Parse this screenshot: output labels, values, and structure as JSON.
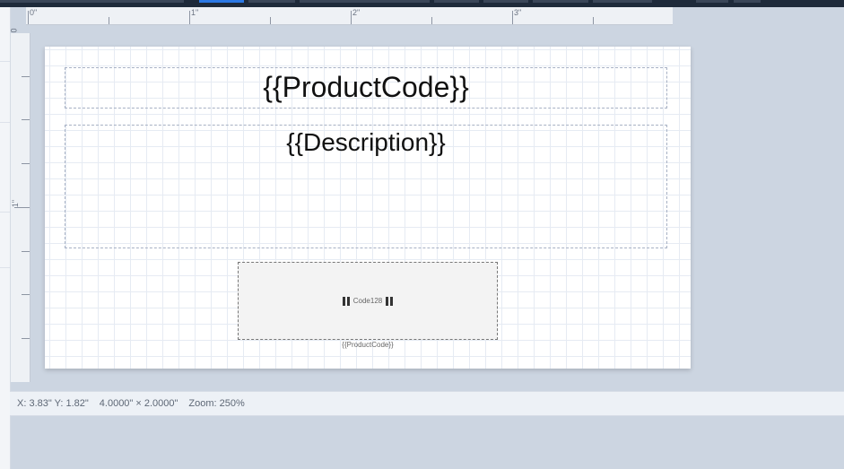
{
  "ruler": {
    "horizontal_labels": [
      "0\"",
      "1\"",
      "2\"",
      "3\""
    ],
    "vertical_labels": [
      "0",
      "1\""
    ]
  },
  "canvas": {
    "fields": {
      "product_code": "{{ProductCode}}",
      "description": "{{Description}}"
    },
    "barcode": {
      "type_label": "Code128",
      "caption": "{{ProductCode}}"
    }
  },
  "status": {
    "coords": "X: 3.83\" Y: 1.82\"",
    "size": "4.0000\" × 2.0000\"",
    "zoom": "Zoom: 250%"
  },
  "colors": {
    "accent": "#2b78e4",
    "workspace": "#ccd5e1",
    "page": "#ffffff"
  }
}
